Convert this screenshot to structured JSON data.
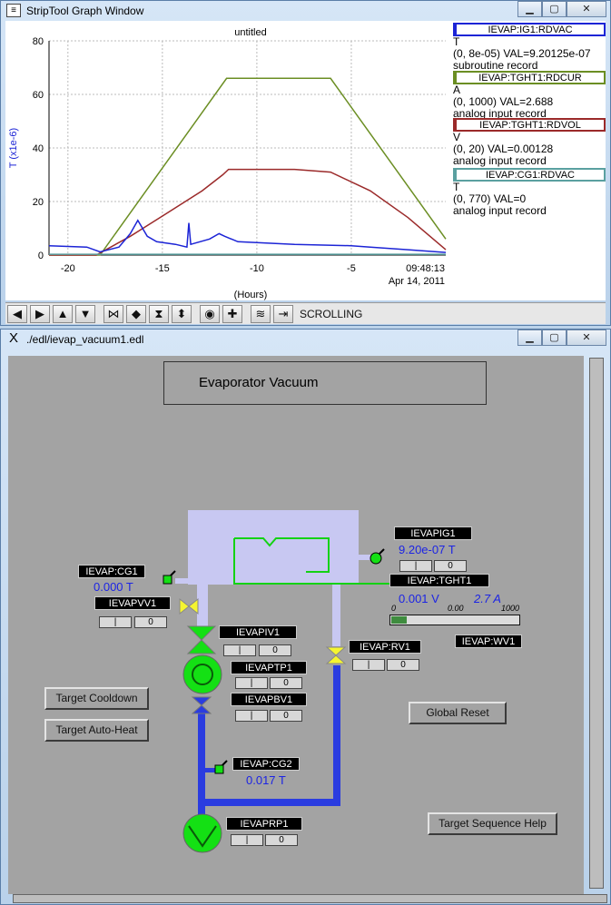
{
  "striptool": {
    "window_title": "StripTool Graph Window",
    "app_icon": "striptool-icon",
    "graph_title": "untitled",
    "ylabel": "T (x1e-6)",
    "xlabel": "(Hours)",
    "time_label": "09:48:13",
    "date_label": "Apr 14, 2011",
    "scroll_mode": "SCROLLING",
    "legend": [
      {
        "pv": "IEVAP:IG1:RDVAC",
        "unit": "T",
        "range": "(0, 8e-05) VAL=9.20125e-07",
        "type": "subroutine record",
        "color": "#1c24d6"
      },
      {
        "pv": "IEVAP:TGHT1:RDCUR",
        "unit": "A",
        "range": "(0, 1000) VAL=2.688",
        "type": "analog input record",
        "color": "#6b8e23"
      },
      {
        "pv": "IEVAP:TGHT1:RDVOL",
        "unit": "V",
        "range": "(0, 20) VAL=0.00128",
        "type": "analog input record",
        "color": "#9b2a2a"
      },
      {
        "pv": "IEVAP:CG1:RDVAC",
        "unit": "T",
        "range": "(0, 770) VAL=0",
        "type": "analog input record",
        "color": "#5aa0a0"
      }
    ],
    "toolbar_icons": [
      "arrow-left-icon",
      "arrow-right-icon",
      "arrow-up-icon",
      "arrow-down-icon",
      "zoom-in-x-icon",
      "zoom-out-x-icon",
      "zoom-in-y-icon",
      "zoom-out-y-icon",
      "reset-icon",
      "add-icon",
      "scroll-icon",
      "end-icon"
    ]
  },
  "chart_data": {
    "type": "line",
    "title": "untitled",
    "xlabel": "(Hours)",
    "ylabel": "T (x1e-6)",
    "xlim": [
      -21,
      0
    ],
    "ylim": [
      0,
      80
    ],
    "xticks": [
      "-20",
      "-15",
      "-10",
      "-5"
    ],
    "yticks": [
      "0",
      "20",
      "40",
      "60",
      "80"
    ],
    "grid": true,
    "series": [
      {
        "name": "IEVAP:TGHT1:RDCUR",
        "color": "#6b8e23",
        "x": [
          -21,
          -18.3,
          -11.6,
          -6.1,
          0
        ],
        "y": [
          0,
          0,
          66,
          66,
          6
        ]
      },
      {
        "name": "IEVAP:TGHT1:RDVOL",
        "color": "#9b2a2a",
        "x": [
          -21,
          -18.5,
          -16.7,
          -14.9,
          -12.9,
          -11.8,
          -11.5,
          -10.0,
          -8.0,
          -6.1,
          -4.0,
          -2.0,
          0
        ],
        "y": [
          0,
          0,
          7,
          15,
          24,
          30,
          32,
          32,
          32,
          31,
          24,
          14,
          2
        ]
      },
      {
        "name": "IEVAP:IG1:RDVAC",
        "color": "#1c24d6",
        "x": [
          -21,
          -19.0,
          -18.3,
          -17.3,
          -16.7,
          -16.3,
          -15.8,
          -15.3,
          -14.3,
          -13.7,
          -13.6,
          -13.5,
          -12.5,
          -12.0,
          -11.7,
          -11.0,
          -8.0,
          -5.0,
          -4.0,
          -2.0,
          0
        ],
        "y": [
          3.5,
          3,
          1.2,
          3,
          8,
          13,
          7,
          5,
          4,
          3,
          12,
          4,
          6,
          8,
          7,
          5,
          4,
          3.5,
          3,
          2,
          1
        ]
      },
      {
        "name": "IEVAP:CG1:RDVAC",
        "color": "#5aa0a0",
        "x": [
          -21,
          0
        ],
        "y": [
          0.3,
          0.3
        ]
      }
    ]
  },
  "edm": {
    "window_title": "./edl/ievap_vacuum1.edl",
    "app_icon": "x-window-icon",
    "panel_title": "Evaporator Vacuum",
    "pvs": {
      "cg1": {
        "label": "IEVAP:CG1",
        "value": "0.000 T"
      },
      "pvv1": {
        "label": "IEVAPVV1"
      },
      "piv1": {
        "label": "IEVAPIV1"
      },
      "ptp1": {
        "label": "IEVAPTP1"
      },
      "pbv1": {
        "label": "IEVAPBV1"
      },
      "cg2": {
        "label": "IEVAP:CG2",
        "value": "0.017 T"
      },
      "prp1": {
        "label": "IEVAPRP1"
      },
      "pig1": {
        "label": "IEVAPIG1",
        "value": "9.20e-07 T"
      },
      "tght1": {
        "label": "IEVAP:TGHT1",
        "volt": "0.001 V",
        "amp": "2.7 A",
        "min": "0",
        "mid": "0.00",
        "max": "1000",
        "fill_fraction": 0.12
      },
      "rv1": {
        "label": "IEVAP:RV1"
      },
      "wv1": {
        "label": "IEVAP:WV1"
      }
    },
    "mini_labels": {
      "off": "|",
      "on": "0"
    },
    "buttons": {
      "cooldown": "Target Cooldown",
      "autoheat": "Target Auto-Heat",
      "reset": "Global Reset",
      "help": "Target Sequence Help"
    },
    "colors": {
      "pipe_light": "#c8c8f2",
      "pipe_dark": "#2a3ce0",
      "pump": "#14e014",
      "valve_yellow": "#f5f530",
      "heater": "#14d214",
      "panel_bg": "#a3a3a3"
    }
  }
}
